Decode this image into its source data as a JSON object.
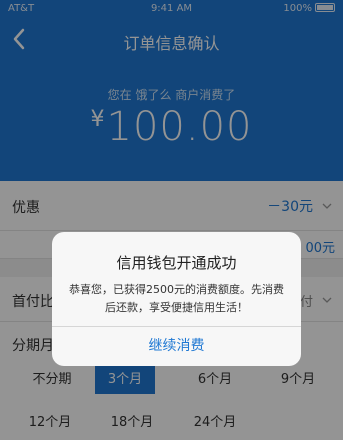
{
  "status_bar": {
    "carrier": "AT&T",
    "time": "9:41 AM",
    "battery": "100%"
  },
  "header": {
    "title": "订单信息确认",
    "merchant_line": "您在 饿了么 商户消费了",
    "currency": "¥",
    "amount": "100.00"
  },
  "discount": {
    "label": "优惠",
    "value": "－30元"
  },
  "limit": {
    "value": "00元"
  },
  "first_payment": {
    "label": "首付比",
    "value": "付"
  },
  "term": {
    "label": "分期月",
    "options": [
      "不分期",
      "3个月",
      "6个月",
      "9个月",
      "12个月",
      "18个月",
      "24个月"
    ],
    "selected": "3个月"
  },
  "dialog": {
    "title": "信用钱包开通成功",
    "message": "恭喜您，已获得2500元的消费额度。先消费后还款，享受便捷信用生活！",
    "button": "继续消费"
  },
  "colors": {
    "primary": "#1f78d3",
    "background": "#f2f2f2"
  }
}
